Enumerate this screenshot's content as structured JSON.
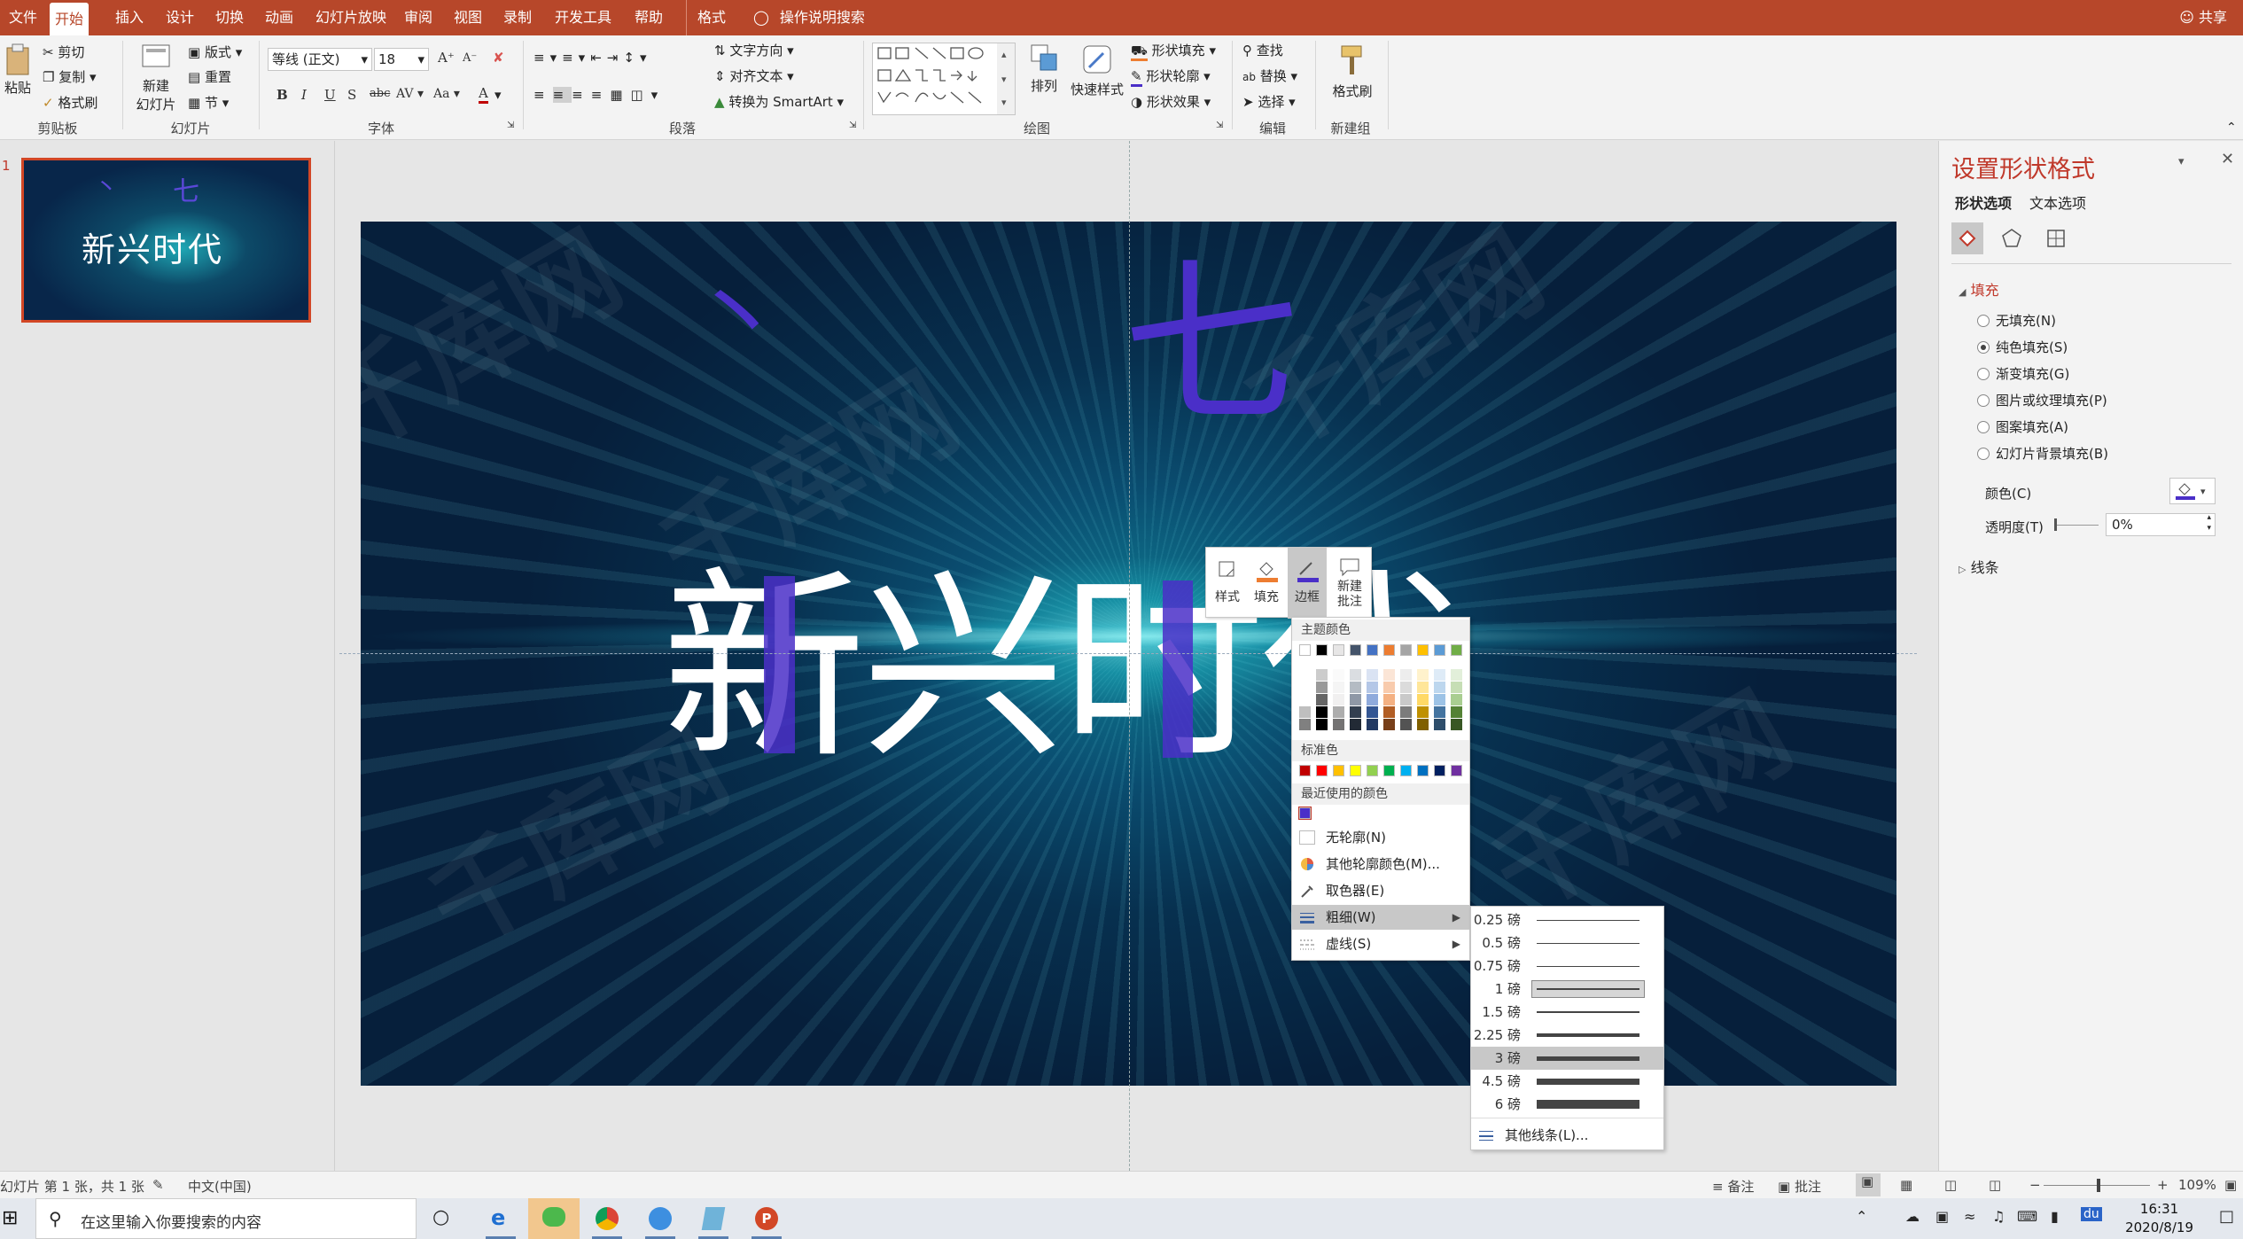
{
  "ribbon_tabs": [
    "文件",
    "开始",
    "插入",
    "设计",
    "切换",
    "动画",
    "幻灯片放映",
    "审阅",
    "视图",
    "录制",
    "开发工具",
    "帮助",
    "格式"
  ],
  "active_tab": "开始",
  "tell_me": "操作说明搜索",
  "share": "共享",
  "clipboard": {
    "paste": "粘贴",
    "cut": "剪切",
    "copy": "复制",
    "format_painter": "格式刷",
    "label": "剪贴板"
  },
  "slides": {
    "new_slide_l1": "新建",
    "new_slide_l2": "幻灯片",
    "layout": "版式",
    "reset": "重置",
    "section": "节",
    "label": "幻灯片"
  },
  "font": {
    "name": "等线 (正文)",
    "size": "18",
    "label": "字体",
    "bold": "B",
    "italic": "I",
    "underline": "U",
    "shadow": "S",
    "strike": "abc",
    "spacing": "AV",
    "case": "Aa",
    "color": "A",
    "grow": "A",
    "shrink": "A"
  },
  "paragraph": {
    "text_direction": "文字方向",
    "align_text": "对齐文本",
    "smartart": "转换为 SmartArt",
    "label": "段落"
  },
  "drawing": {
    "arrange": "排列",
    "quick_styles": "快速样式",
    "shape_fill": "形状填充",
    "shape_outline": "形状轮廓",
    "shape_effects": "形状效果",
    "label": "绘图"
  },
  "editing": {
    "find": "查找",
    "replace": "替换",
    "select": "选择",
    "label": "编辑"
  },
  "new_group": {
    "format_painter": "格式刷",
    "label": "新建组"
  },
  "thumbnail": {
    "number": "1",
    "title_parts": [
      "新",
      "兴",
      "时",
      "代"
    ]
  },
  "slide": {
    "top_marks": [
      "丶",
      "七"
    ],
    "title_chars": [
      "新",
      "兴",
      "时",
      "代"
    ],
    "watermark": "千库网"
  },
  "minitoolbar": {
    "style": "样式",
    "fill": "填充",
    "border": "边框",
    "new_comment_l1": "新建",
    "new_comment_l2": "批注"
  },
  "color_menu": {
    "theme_colors": "主题颜色",
    "standard_colors": "标准色",
    "recent_colors": "最近使用的颜色",
    "no_outline": "无轮廓(N)",
    "more_colors": "其他轮廓颜色(M)...",
    "eyedropper": "取色器(E)",
    "weight": "粗细(W)",
    "dashes": "虚线(S)",
    "theme_top": [
      "#ffffff",
      "#000000",
      "#e7e6e6",
      "#44546a",
      "#4472c4",
      "#ed7d31",
      "#a5a5a5",
      "#ffc000",
      "#5b9bd5",
      "#70ad47"
    ],
    "standard": [
      "#c00000",
      "#ff0000",
      "#ffc000",
      "#ffff00",
      "#92d050",
      "#00b050",
      "#00b0f0",
      "#0070c0",
      "#002060",
      "#7030a0"
    ],
    "recent": [
      "#4a2fc8"
    ]
  },
  "weights": [
    {
      "label": "0.25 磅",
      "pt": 0.25
    },
    {
      "label": "0.5 磅",
      "pt": 0.5
    },
    {
      "label": "0.75 磅",
      "pt": 0.75
    },
    {
      "label": "1 磅",
      "pt": 1
    },
    {
      "label": "1.5 磅",
      "pt": 1.5
    },
    {
      "label": "2.25 磅",
      "pt": 2.25
    },
    {
      "label": "3 磅",
      "pt": 3
    },
    {
      "label": "4.5 磅",
      "pt": 4.5
    },
    {
      "label": "6 磅",
      "pt": 6
    }
  ],
  "more_lines": "其他线条(L)...",
  "format_pane": {
    "title": "设置形状格式",
    "tab_shape": "形状选项",
    "tab_text": "文本选项",
    "fill_section": "填充",
    "options": [
      "无填充(N)",
      "纯色填充(S)",
      "渐变填充(G)",
      "图片或纹理填充(P)",
      "图案填充(A)",
      "幻灯片背景填充(B)"
    ],
    "selected_option": "纯色填充(S)",
    "color_label": "颜色(C)",
    "transparency_label": "透明度(T)",
    "transparency_value": "0%",
    "line_section": "线条"
  },
  "status": {
    "slide_info": "幻灯片 第 1 张，共 1 张",
    "language": "中文(中国)",
    "notes": "备注",
    "comments": "批注",
    "zoom": "109%"
  },
  "taskbar": {
    "search_placeholder": "在这里输入你要搜索的内容",
    "time": "16:31",
    "date": "2020/8/19"
  }
}
